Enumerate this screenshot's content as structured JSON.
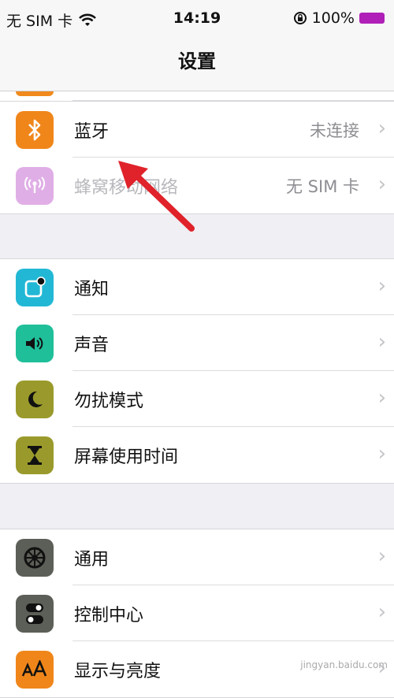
{
  "status_bar": {
    "carrier": "无 SIM 卡",
    "time": "14:19",
    "battery": "100%",
    "battery_color": "#b01fb8"
  },
  "navbar": {
    "title": "设置"
  },
  "groups": [
    {
      "items": [
        {
          "label": "蓝牙",
          "value": "未连接",
          "icon": "bluetooth-icon",
          "color": "#f0861a"
        },
        {
          "label": "蜂窝移动网络",
          "value": "无 SIM 卡",
          "icon": "cellular-antenna-icon",
          "color": "#d99be0",
          "disabled": true
        }
      ]
    },
    {
      "items": [
        {
          "label": "通知",
          "icon": "notification-icon",
          "color": "#22b8d5"
        },
        {
          "label": "声音",
          "icon": "speaker-icon",
          "color": "#1fbf9a"
        },
        {
          "label": "勿扰模式",
          "icon": "moon-icon",
          "color": "#9a9a2c"
        },
        {
          "label": "屏幕使用时间",
          "icon": "hourglass-icon",
          "color": "#9a9a2c"
        }
      ]
    },
    {
      "items": [
        {
          "label": "通用",
          "icon": "gear-icon",
          "color": "#5c5f57"
        },
        {
          "label": "控制中心",
          "icon": "toggle-icon",
          "color": "#5c5f57"
        },
        {
          "label": "显示与亮度",
          "icon": "text-size-icon",
          "color": "#f0861a"
        }
      ]
    }
  ],
  "chevron": "›",
  "watermark": "jingyan.baidu.com",
  "annotation": {
    "arrow_color": "#e0222a"
  }
}
